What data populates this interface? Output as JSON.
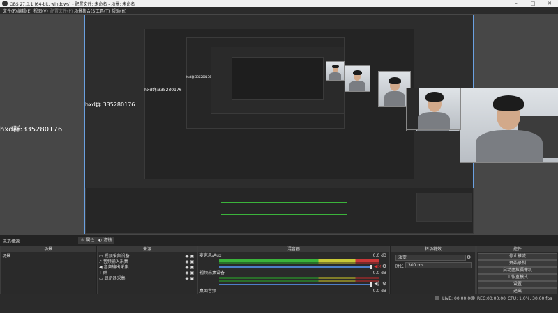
{
  "window": {
    "title": "OBS 27.0.1 (64-bit, windows) - 配置文件: 未命名 - 场景: 未命名"
  },
  "menu": [
    "文件(F)",
    "编辑(E)",
    "视图(V)",
    "配置文件(P)",
    "场景集合(S)",
    "工具(T)",
    "帮助(H)"
  ],
  "preview": {
    "scene_text": "hxd群:335280176"
  },
  "dock_tabs": {
    "scenes": "未选择源",
    "filters": "属性",
    "properties": "滤镜"
  },
  "scenes_panel": {
    "header": "场景",
    "items": [
      "场景"
    ]
  },
  "sources_panel": {
    "header": "来源",
    "items": [
      {
        "label": "视频采集设备",
        "icon": "camera-icon"
      },
      {
        "label": "音频输入采集",
        "icon": "mic-icon"
      },
      {
        "label": "音频输出采集",
        "icon": "speaker-icon"
      },
      {
        "label": "群",
        "icon": "text-icon"
      },
      {
        "label": "显示器采集",
        "icon": "monitor-icon"
      }
    ]
  },
  "mixer_panel": {
    "header": "混音器",
    "channels": [
      {
        "name": "麦克风/Aux",
        "db": "0.0 dB"
      },
      {
        "name": "视频采集设备",
        "db": "0.0 dB"
      },
      {
        "name": "桌面音频",
        "db": "0.0 dB"
      }
    ]
  },
  "transitions_panel": {
    "header": "转场特效",
    "type": "淡变",
    "duration_label": "时长",
    "duration_value": "300 ms"
  },
  "controls_panel": {
    "header": "控件",
    "buttons": [
      "停止推流",
      "开始录制",
      "启动虚拟摄像机",
      "工作室模式",
      "设置",
      "退出"
    ]
  },
  "status_bar": {
    "live_label": "LIVE:",
    "live_time": "00:00:00",
    "rec_label": "REC:",
    "rec_time": "00:00:00",
    "cpu": "CPU: 1.0%, 30.00 fps"
  },
  "colors": {
    "accent": "#4d7fc8",
    "meter_green": "#3bb33b",
    "meter_yellow": "#c8c838",
    "meter_red": "#c83838"
  }
}
